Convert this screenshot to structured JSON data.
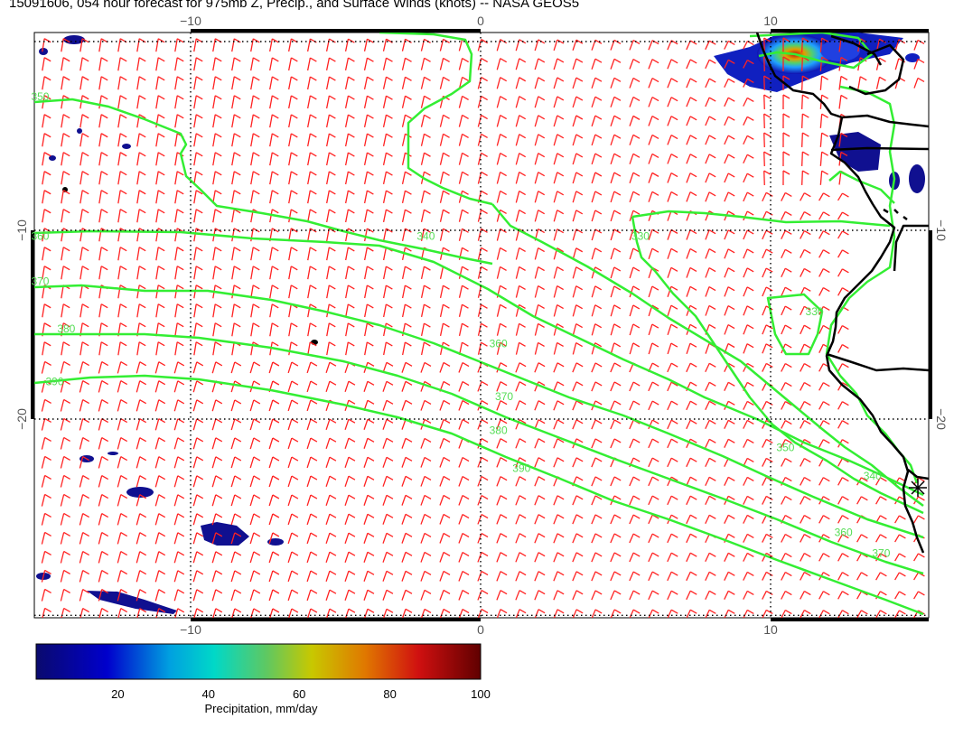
{
  "title": "15091606, 054 hour forecast for 975mb Z, Precip., and Surface Winds (knots) -- NASA GEOS5",
  "map": {
    "lon_ticks": [
      {
        "value": -10,
        "label": "−10"
      },
      {
        "value": 0,
        "label": "0"
      },
      {
        "value": 10,
        "label": "10"
      }
    ],
    "lat_ticks": [
      {
        "value": -10,
        "label": "−10"
      },
      {
        "value": -20,
        "label": "−20"
      }
    ],
    "contour_labels": [
      {
        "text": "340",
        "lon": -2.2,
        "lat": -10.5
      },
      {
        "text": "330",
        "lon": 5.2,
        "lat": -10.5
      },
      {
        "text": "340",
        "lon": -3.5,
        "lat": 9.5
      },
      {
        "text": "330",
        "lon": 11.2,
        "lat": -14.5
      },
      {
        "text": "350",
        "lon": -15.5,
        "lat": -3.1
      },
      {
        "text": "360",
        "lon": -15.5,
        "lat": -10.5
      },
      {
        "text": "370",
        "lon": -15.5,
        "lat": -12.9
      },
      {
        "text": "380",
        "lon": -14.6,
        "lat": -15.4
      },
      {
        "text": "390",
        "lon": -15.0,
        "lat": -18.2
      },
      {
        "text": "360",
        "lon": 0.3,
        "lat": -16.2
      },
      {
        "text": "370",
        "lon": 0.5,
        "lat": -19.0
      },
      {
        "text": "380",
        "lon": 0.3,
        "lat": -20.8
      },
      {
        "text": "390",
        "lon": 1.1,
        "lat": -22.8
      },
      {
        "text": "350",
        "lon": 10.2,
        "lat": -21.7
      },
      {
        "text": "340",
        "lon": 13.2,
        "lat": -23.2
      },
      {
        "text": "360",
        "lon": 12.2,
        "lat": -26.2
      },
      {
        "text": "370",
        "lon": 13.5,
        "lat": -27.3
      }
    ],
    "colors": {
      "contour": "#33ee33",
      "wind_barb": "#ff2222",
      "coastline": "#000000"
    }
  },
  "colorbar": {
    "label": "Precipitation, mm/day",
    "ticks": [
      {
        "value": 20,
        "label": "20"
      },
      {
        "value": 40,
        "label": "40"
      },
      {
        "value": 60,
        "label": "60"
      },
      {
        "value": 80,
        "label": "80"
      },
      {
        "value": 100,
        "label": "100"
      }
    ],
    "min": 2,
    "max": 100
  }
}
